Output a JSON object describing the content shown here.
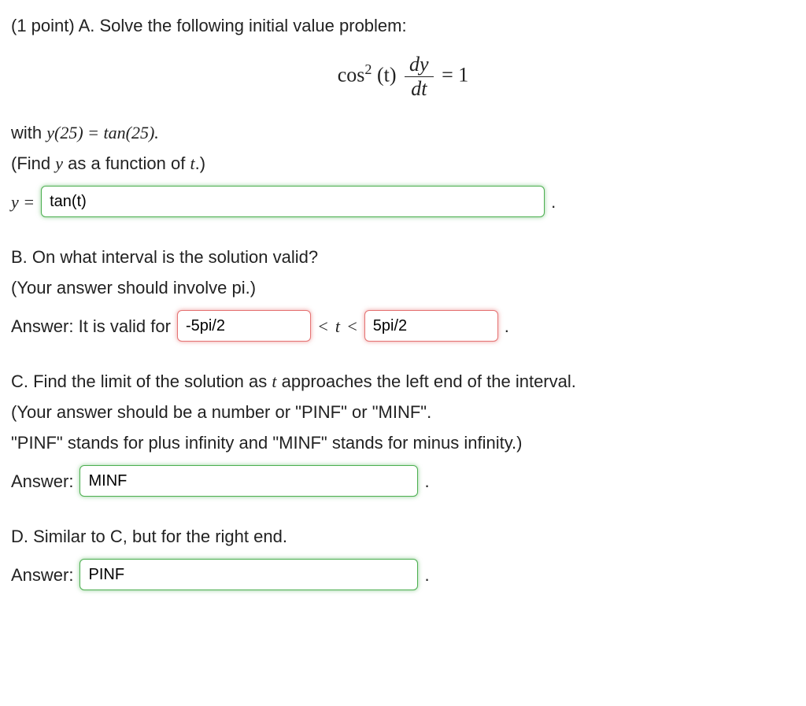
{
  "partA": {
    "header": "(1 point) A. Solve the following initial value problem:",
    "equation_lhs_cos": "cos",
    "equation_lhs_t": "(t)",
    "equation_frac_num": "dy",
    "equation_frac_den": "dt",
    "equation_rhs": " = 1",
    "with_text_pre": "with ",
    "with_text_expr": "y(25) = tan(25).",
    "find_text_pre": "(Find ",
    "find_text_y": "y",
    "find_text_mid": " as a function of ",
    "find_text_t": "t",
    "find_text_post": ".)",
    "y_eq": "y = ",
    "y_value": "tan(t)",
    "period": "."
  },
  "partB": {
    "q1": "B. On what interval is the solution valid?",
    "q2": "(Your answer should involve pi.)",
    "prefix": "Answer: It is valid for ",
    "lower": "-5pi/2",
    "mid_lt": " < ",
    "mid_t": "t",
    "mid_lt2": " < ",
    "upper": "5pi/2",
    "period": "."
  },
  "partC": {
    "q1_pre": "C. Find the limit of the solution as ",
    "q1_t": "t",
    "q1_post": " approaches the left end of the interval.",
    "q2": "(Your answer should be a number or \"PINF\" or \"MINF\".",
    "q3": "\"PINF\" stands for plus infinity and \"MINF\" stands for minus infinity.)",
    "prefix": "Answer: ",
    "value": "MINF",
    "period": "."
  },
  "partD": {
    "q1": "D. Similar to C, but for the right end.",
    "prefix": "Answer: ",
    "value": "PINF",
    "period": "."
  }
}
